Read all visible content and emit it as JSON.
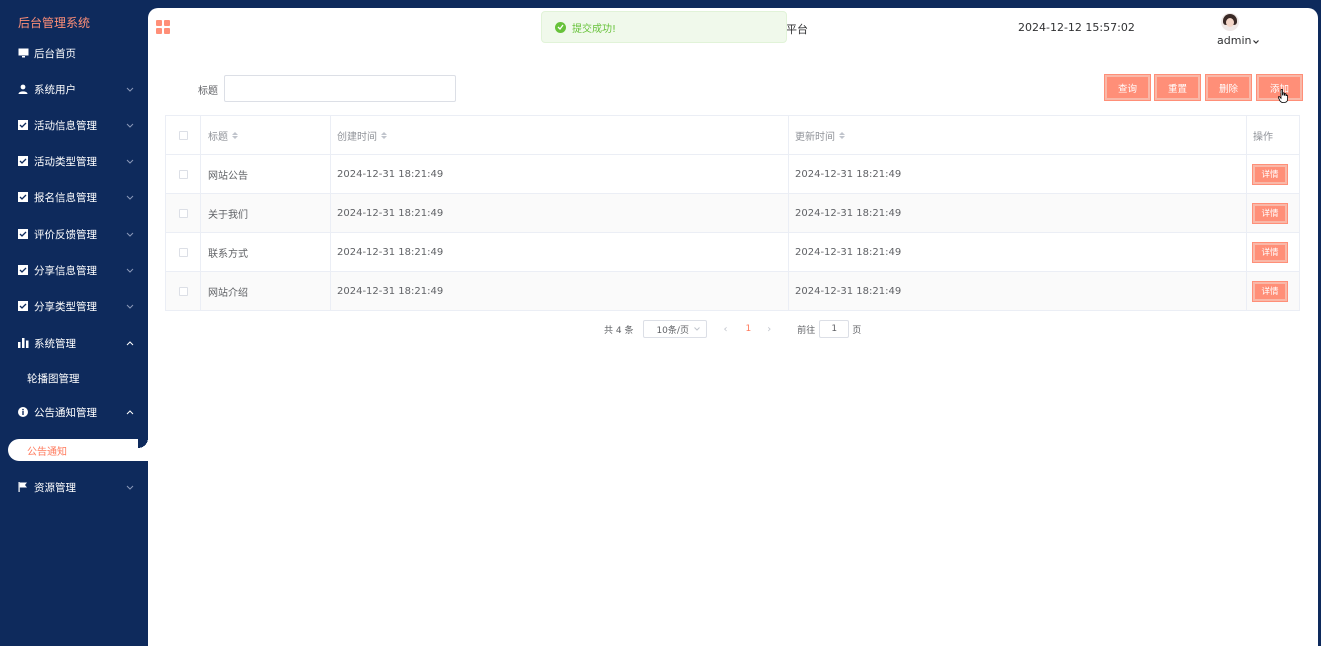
{
  "sidebar": {
    "title": "后台管理系统",
    "items": [
      {
        "label": "后台首页",
        "icon": "monitor-icon"
      },
      {
        "label": "系统用户",
        "icon": "user-icon"
      },
      {
        "label": "活动信息管理",
        "icon": "checkbox-icon"
      },
      {
        "label": "活动类型管理",
        "icon": "checkbox-icon"
      },
      {
        "label": "报名信息管理",
        "icon": "checkbox-icon"
      },
      {
        "label": "评价反馈管理",
        "icon": "checkbox-icon"
      },
      {
        "label": "分享信息管理",
        "icon": "checkbox-icon"
      },
      {
        "label": "分享类型管理",
        "icon": "checkbox-icon"
      },
      {
        "label": "系统管理",
        "icon": "bar-chart-icon"
      },
      {
        "label": "公告通知管理",
        "icon": "info-icon"
      },
      {
        "label": "资源管理",
        "icon": "flag-icon"
      }
    ],
    "sub_items": {
      "system": "轮播图管理",
      "notice_active": "公告通知"
    }
  },
  "header": {
    "title_fragment": "平台",
    "datetime": "2024-12-12 15:57:02",
    "username": "admin"
  },
  "toast": {
    "message": "提交成功!"
  },
  "search": {
    "label": "标题",
    "value": ""
  },
  "toolbar": {
    "query": "查询",
    "reset": "重置",
    "delete": "删除",
    "add": "添加"
  },
  "table": {
    "headers": {
      "title": "标题",
      "created": "创建时间",
      "updated": "更新时间",
      "action": "操作"
    },
    "rows": [
      {
        "title": "网站公告",
        "created": "2024-12-31 18:21:49",
        "updated": "2024-12-31 18:21:49",
        "action": "详情"
      },
      {
        "title": "关于我们",
        "created": "2024-12-31 18:21:49",
        "updated": "2024-12-31 18:21:49",
        "action": "详情"
      },
      {
        "title": "联系方式",
        "created": "2024-12-31 18:21:49",
        "updated": "2024-12-31 18:21:49",
        "action": "详情"
      },
      {
        "title": "网站介绍",
        "created": "2024-12-31 18:21:49",
        "updated": "2024-12-31 18:21:49",
        "action": "详情"
      }
    ]
  },
  "pagination": {
    "total": "共 4 条",
    "page_size": "10条/页",
    "current_page": "1",
    "goto_label": "前往",
    "goto_value": "1",
    "goto_unit": "页"
  },
  "colors": {
    "sidebar_bg": "#0e2a5c",
    "accent": "#ff8f78",
    "success": "#67c23a"
  }
}
